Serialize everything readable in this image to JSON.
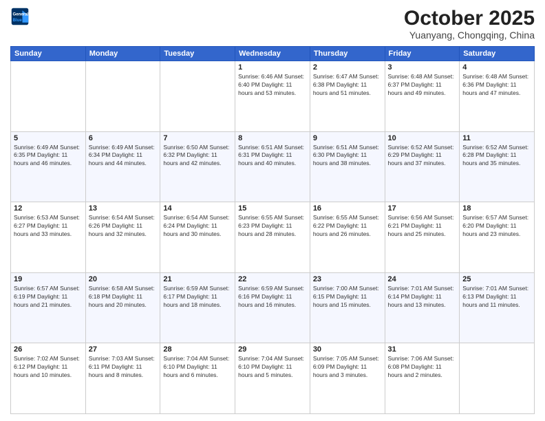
{
  "header": {
    "logo_line1": "General",
    "logo_line2": "Blue",
    "title": "October 2025",
    "subtitle": "Yuanyang, Chongqing, China"
  },
  "weekdays": [
    "Sunday",
    "Monday",
    "Tuesday",
    "Wednesday",
    "Thursday",
    "Friday",
    "Saturday"
  ],
  "weeks": [
    [
      {
        "day": "",
        "info": ""
      },
      {
        "day": "",
        "info": ""
      },
      {
        "day": "",
        "info": ""
      },
      {
        "day": "1",
        "info": "Sunrise: 6:46 AM\nSunset: 6:40 PM\nDaylight: 11 hours and 53 minutes."
      },
      {
        "day": "2",
        "info": "Sunrise: 6:47 AM\nSunset: 6:38 PM\nDaylight: 11 hours and 51 minutes."
      },
      {
        "day": "3",
        "info": "Sunrise: 6:48 AM\nSunset: 6:37 PM\nDaylight: 11 hours and 49 minutes."
      },
      {
        "day": "4",
        "info": "Sunrise: 6:48 AM\nSunset: 6:36 PM\nDaylight: 11 hours and 47 minutes."
      }
    ],
    [
      {
        "day": "5",
        "info": "Sunrise: 6:49 AM\nSunset: 6:35 PM\nDaylight: 11 hours and 46 minutes."
      },
      {
        "day": "6",
        "info": "Sunrise: 6:49 AM\nSunset: 6:34 PM\nDaylight: 11 hours and 44 minutes."
      },
      {
        "day": "7",
        "info": "Sunrise: 6:50 AM\nSunset: 6:32 PM\nDaylight: 11 hours and 42 minutes."
      },
      {
        "day": "8",
        "info": "Sunrise: 6:51 AM\nSunset: 6:31 PM\nDaylight: 11 hours and 40 minutes."
      },
      {
        "day": "9",
        "info": "Sunrise: 6:51 AM\nSunset: 6:30 PM\nDaylight: 11 hours and 38 minutes."
      },
      {
        "day": "10",
        "info": "Sunrise: 6:52 AM\nSunset: 6:29 PM\nDaylight: 11 hours and 37 minutes."
      },
      {
        "day": "11",
        "info": "Sunrise: 6:52 AM\nSunset: 6:28 PM\nDaylight: 11 hours and 35 minutes."
      }
    ],
    [
      {
        "day": "12",
        "info": "Sunrise: 6:53 AM\nSunset: 6:27 PM\nDaylight: 11 hours and 33 minutes."
      },
      {
        "day": "13",
        "info": "Sunrise: 6:54 AM\nSunset: 6:26 PM\nDaylight: 11 hours and 32 minutes."
      },
      {
        "day": "14",
        "info": "Sunrise: 6:54 AM\nSunset: 6:24 PM\nDaylight: 11 hours and 30 minutes."
      },
      {
        "day": "15",
        "info": "Sunrise: 6:55 AM\nSunset: 6:23 PM\nDaylight: 11 hours and 28 minutes."
      },
      {
        "day": "16",
        "info": "Sunrise: 6:55 AM\nSunset: 6:22 PM\nDaylight: 11 hours and 26 minutes."
      },
      {
        "day": "17",
        "info": "Sunrise: 6:56 AM\nSunset: 6:21 PM\nDaylight: 11 hours and 25 minutes."
      },
      {
        "day": "18",
        "info": "Sunrise: 6:57 AM\nSunset: 6:20 PM\nDaylight: 11 hours and 23 minutes."
      }
    ],
    [
      {
        "day": "19",
        "info": "Sunrise: 6:57 AM\nSunset: 6:19 PM\nDaylight: 11 hours and 21 minutes."
      },
      {
        "day": "20",
        "info": "Sunrise: 6:58 AM\nSunset: 6:18 PM\nDaylight: 11 hours and 20 minutes."
      },
      {
        "day": "21",
        "info": "Sunrise: 6:59 AM\nSunset: 6:17 PM\nDaylight: 11 hours and 18 minutes."
      },
      {
        "day": "22",
        "info": "Sunrise: 6:59 AM\nSunset: 6:16 PM\nDaylight: 11 hours and 16 minutes."
      },
      {
        "day": "23",
        "info": "Sunrise: 7:00 AM\nSunset: 6:15 PM\nDaylight: 11 hours and 15 minutes."
      },
      {
        "day": "24",
        "info": "Sunrise: 7:01 AM\nSunset: 6:14 PM\nDaylight: 11 hours and 13 minutes."
      },
      {
        "day": "25",
        "info": "Sunrise: 7:01 AM\nSunset: 6:13 PM\nDaylight: 11 hours and 11 minutes."
      }
    ],
    [
      {
        "day": "26",
        "info": "Sunrise: 7:02 AM\nSunset: 6:12 PM\nDaylight: 11 hours and 10 minutes."
      },
      {
        "day": "27",
        "info": "Sunrise: 7:03 AM\nSunset: 6:11 PM\nDaylight: 11 hours and 8 minutes."
      },
      {
        "day": "28",
        "info": "Sunrise: 7:04 AM\nSunset: 6:10 PM\nDaylight: 11 hours and 6 minutes."
      },
      {
        "day": "29",
        "info": "Sunrise: 7:04 AM\nSunset: 6:10 PM\nDaylight: 11 hours and 5 minutes."
      },
      {
        "day": "30",
        "info": "Sunrise: 7:05 AM\nSunset: 6:09 PM\nDaylight: 11 hours and 3 minutes."
      },
      {
        "day": "31",
        "info": "Sunrise: 7:06 AM\nSunset: 6:08 PM\nDaylight: 11 hours and 2 minutes."
      },
      {
        "day": "",
        "info": ""
      }
    ]
  ]
}
